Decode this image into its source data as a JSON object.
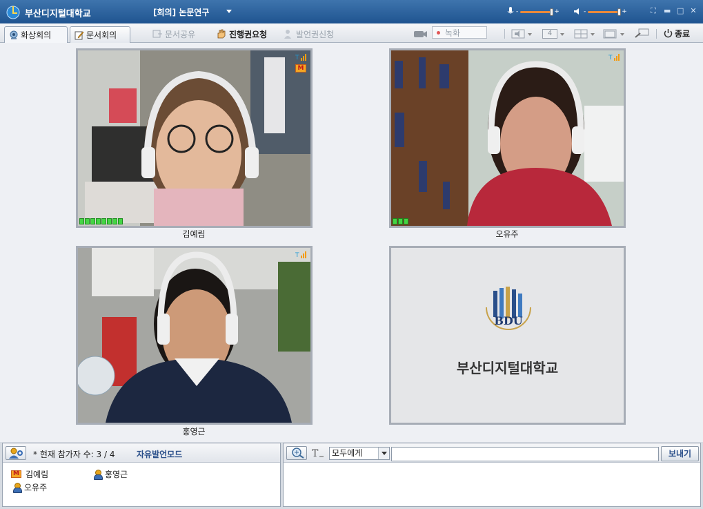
{
  "app": {
    "title": "부산디지털대학교",
    "meeting_title": "[회의] 논문연구"
  },
  "tabs": [
    {
      "label": "화상회의"
    },
    {
      "label": "문서회의"
    }
  ],
  "toolbar": {
    "share_doc": "문서공유",
    "request_control": "진행권요청",
    "request_speech": "발언권신청",
    "record": "녹화",
    "layout_count": "4",
    "exit": "종료"
  },
  "videos": [
    {
      "name": "김예림"
    },
    {
      "name": "오유주"
    },
    {
      "name": "홍영근"
    }
  ],
  "logo_panel": {
    "school_name": "부산디지털대학교",
    "logo_text": "BDU"
  },
  "participants_panel": {
    "count_text": "* 현재 참가자 수: 3 / 4",
    "mode": "자유발언모드",
    "participants": [
      {
        "name": "김예림",
        "role": "M"
      },
      {
        "name": "홍영근",
        "role": "user"
      },
      {
        "name": "오유주",
        "role": "user"
      }
    ]
  },
  "chat": {
    "target": "모두에게",
    "input_value": "",
    "send": "보내기"
  },
  "colors": {
    "titlebar": "#2a5f9c",
    "accent": "#e9893b",
    "brand_blue": "#2a4f8a"
  }
}
